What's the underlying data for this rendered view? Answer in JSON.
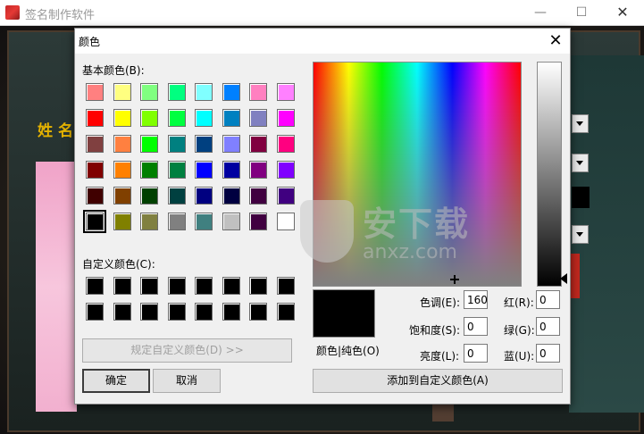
{
  "app": {
    "title": "签名制作软件",
    "minimize_glyph": "—",
    "maximize_glyph": "☐",
    "close_glyph": "✕",
    "name_label": "姓名"
  },
  "dialog": {
    "title": "颜色",
    "close_glyph": "✕",
    "basic_colors_label": "基本颜色(B):",
    "custom_colors_label": "自定义颜色(C):",
    "define_custom_button": "规定自定义颜色(D) >>",
    "ok_button": "确定",
    "cancel_button": "取消",
    "color_solid_label": "颜色|纯色(O)",
    "add_custom_button": "添加到自定义颜色(A)",
    "fields": {
      "hue_label": "色调(E):",
      "hue_value": "160",
      "sat_label": "饱和度(S):",
      "sat_value": "0",
      "lum_label": "亮度(L):",
      "lum_value": "0",
      "red_label": "红(R):",
      "red_value": "0",
      "green_label": "绿(G):",
      "green_value": "0",
      "blue_label": "蓝(U):",
      "blue_value": "0"
    },
    "basic_colors": [
      "#ff8080",
      "#ffff80",
      "#80ff80",
      "#00ff80",
      "#80ffff",
      "#0080ff",
      "#ff80c0",
      "#ff80ff",
      "#ff0000",
      "#ffff00",
      "#80ff00",
      "#00ff40",
      "#00ffff",
      "#0080c0",
      "#8080c0",
      "#ff00ff",
      "#804040",
      "#ff8040",
      "#00ff00",
      "#008080",
      "#004080",
      "#8080ff",
      "#800040",
      "#ff0080",
      "#800000",
      "#ff8000",
      "#008000",
      "#008040",
      "#0000ff",
      "#0000a0",
      "#800080",
      "#8000ff",
      "#400000",
      "#804000",
      "#004000",
      "#004040",
      "#000080",
      "#000040",
      "#400040",
      "#400080",
      "#000000",
      "#808000",
      "#808040",
      "#808080",
      "#408080",
      "#c0c0c0",
      "#400040",
      "#ffffff"
    ],
    "selected_index": 40,
    "custom_colors": [
      "#000000",
      "#000000",
      "#000000",
      "#000000",
      "#000000",
      "#000000",
      "#000000",
      "#000000",
      "#000000",
      "#000000",
      "#000000",
      "#000000",
      "#000000",
      "#000000",
      "#000000",
      "#000000"
    ],
    "watermark_text": "安下载",
    "watermark_sub": "anxz.com"
  }
}
